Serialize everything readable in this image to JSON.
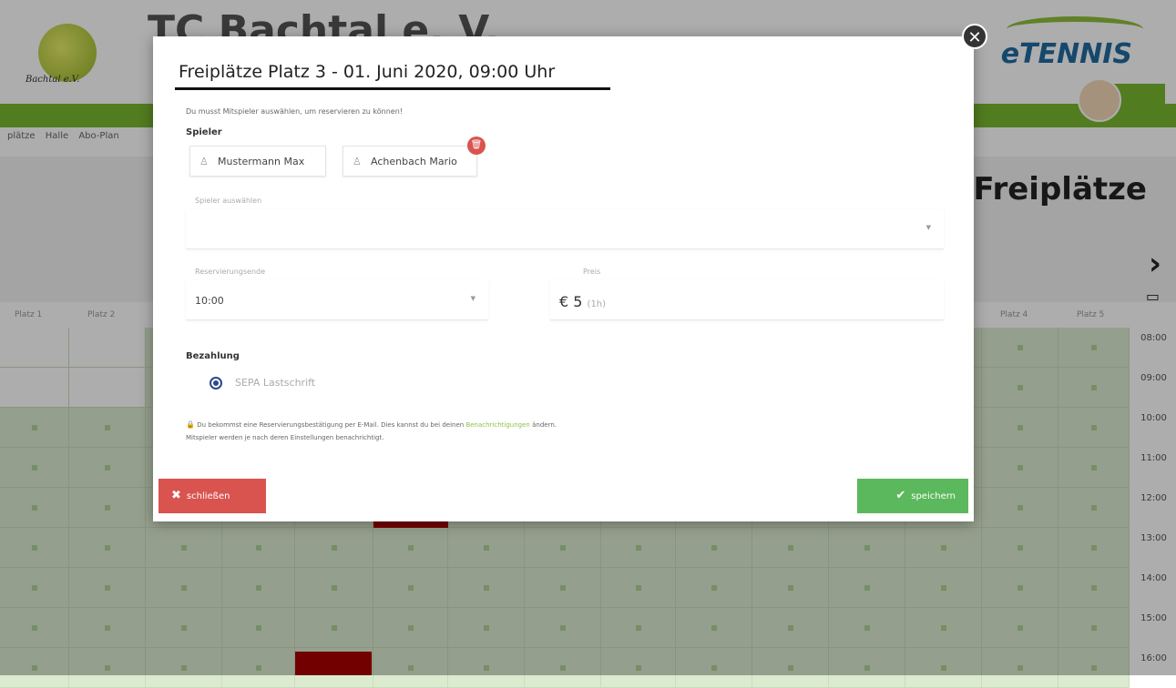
{
  "background": {
    "club_name": "TC Bachtal e. V.",
    "logo_caption": "Bachtal e.V.",
    "brand": "eTENNIS",
    "nav_items": [
      "plätze",
      "Halle",
      "Abo-Plan"
    ],
    "page_title": "Freiplätze",
    "court_headers_left": [
      "Platz 1",
      "Platz 2"
    ],
    "court_headers_right": [
      "Platz 4",
      "Platz 5"
    ],
    "times": [
      "08:00",
      "09:00",
      "10:00",
      "11:00",
      "12:00",
      "13:00",
      "14:00",
      "15:00",
      "16:00"
    ],
    "colors": {
      "green": "#7ab730",
      "free_cell": "#dcebd0",
      "booked": "#a80000"
    }
  },
  "modal": {
    "title": "Freiplätze Platz 3 - 01. Juni 2020, 09:00 Uhr",
    "hint": "Du musst Mitspieler auswählen, um reservieren zu können!",
    "players_label": "Spieler",
    "players": [
      "Mustermann Max",
      "Achenbach Mario"
    ],
    "player_select": {
      "label": "Spieler auswählen",
      "value": ""
    },
    "reservation_end": {
      "label": "Reservierungsende",
      "value": "10:00"
    },
    "price": {
      "label": "Preis",
      "value": "€ 5",
      "unit": "(1h)"
    },
    "payment_label": "Bezahlung",
    "payment_option": "SEPA Lastschrift",
    "info_text_1": "Du bekommst eine Reservierungsbestätigung per E-Mail. Dies kannst du bei deinen",
    "info_link": "Benachrichtigungen",
    "info_text_2": "ändern.",
    "info_text_3": "Mitspieler werden je nach deren Einstellungen benachrichtigt.",
    "close_label": "schließen",
    "save_label": "speichern",
    "colors": {
      "close": "#d9534f",
      "save": "#5cb85c",
      "radio": "#2b4a8b"
    }
  }
}
